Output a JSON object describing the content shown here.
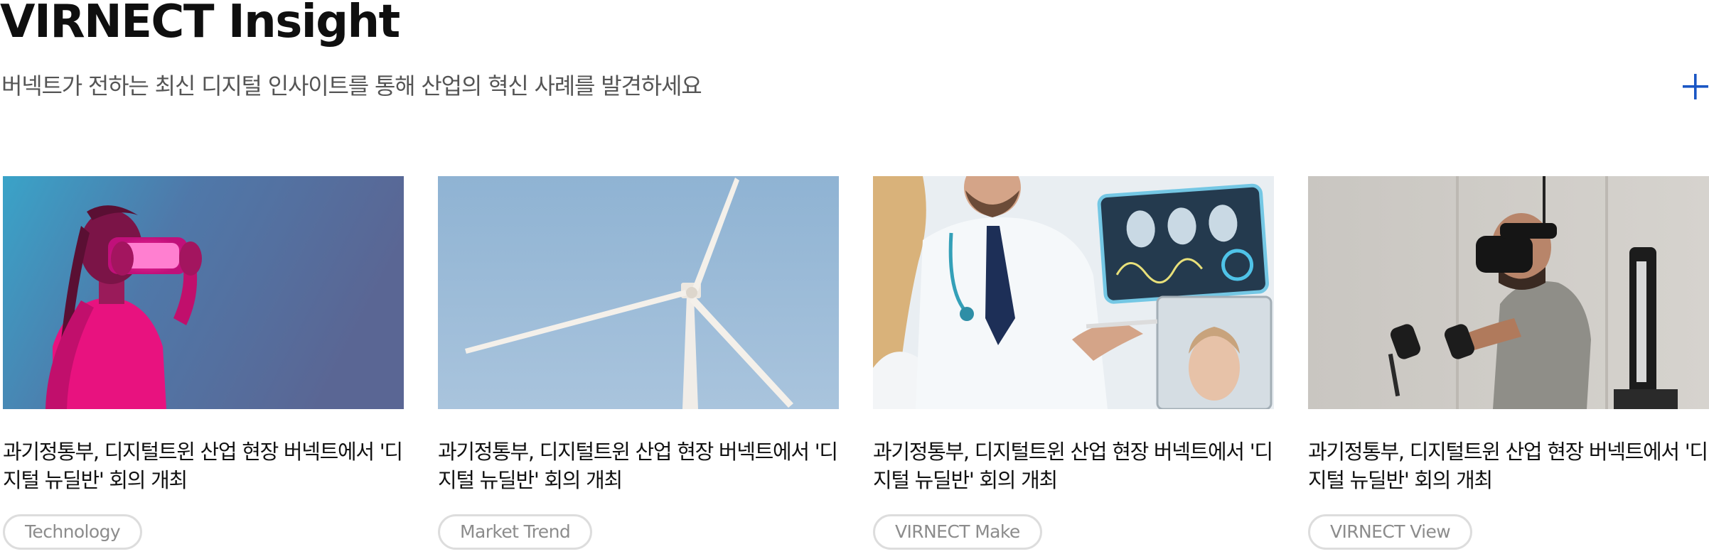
{
  "header": {
    "title": "VIRNECT Insight",
    "subtitle": "버넥트가 전하는 최신 디지털 인사이트를 통해 산업의 혁신 사례를 발견하세요",
    "more_icon": "plus-icon",
    "accent_color": "#1a56c4"
  },
  "cards": [
    {
      "image": "woman-vr-headset-image",
      "headline": "과기정통부, 디지털트윈 산업 현장 버넥트에서 '디지털 뉴딜반' 회의 개최",
      "tag": "Technology"
    },
    {
      "image": "wind-turbine-image",
      "headline": "과기정통부, 디지털트윈 산업 현장 버넥트에서 '디지털 뉴딜반' 회의 개최",
      "tag": "Market Trend"
    },
    {
      "image": "doctors-tablet-image",
      "headline": "과기정통부, 디지털트윈 산업 현장 버넥트에서 '디지털 뉴딜반' 회의 개최",
      "tag": "VIRNECT Make"
    },
    {
      "image": "man-vr-controllers-image",
      "headline": "과기정통부, 디지털트윈 산업 현장 버넥트에서 '디지털 뉴딜반' 회의 개최",
      "tag": "VIRNECT View"
    }
  ]
}
